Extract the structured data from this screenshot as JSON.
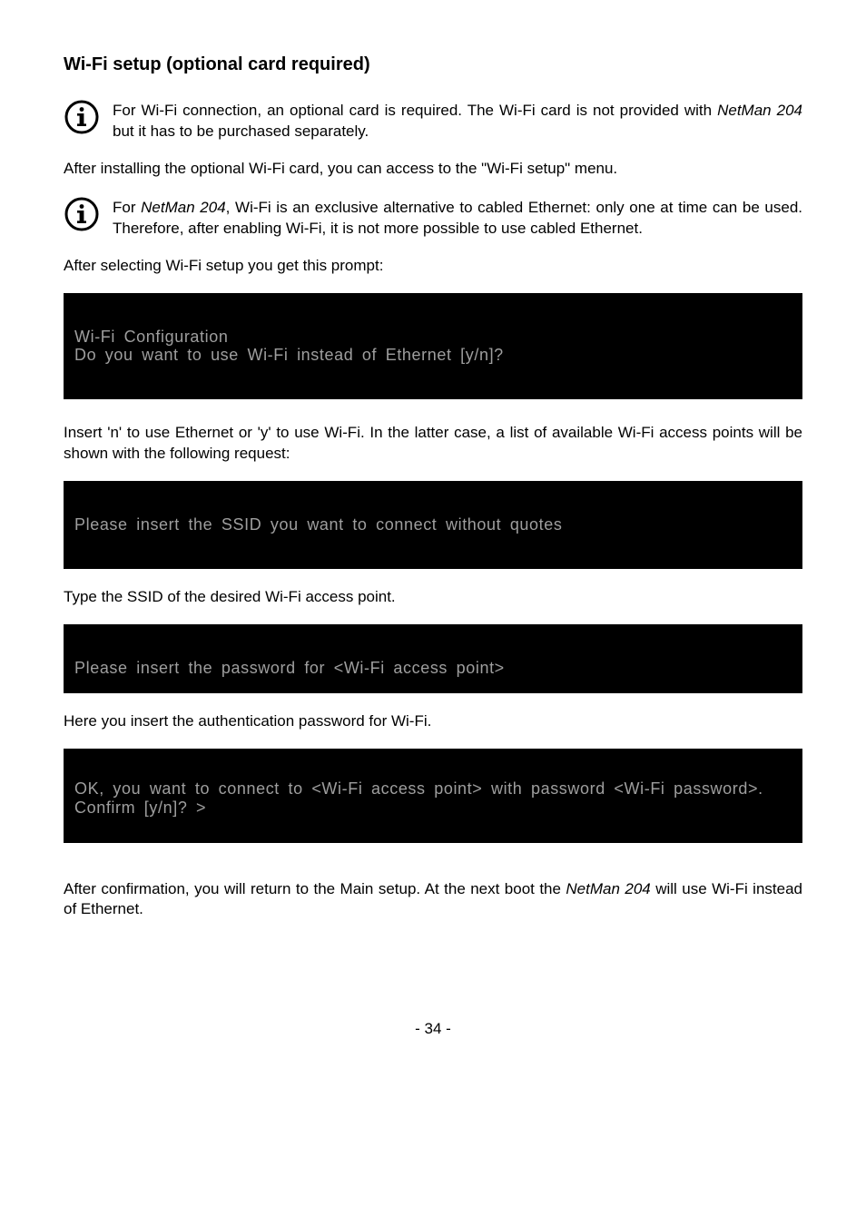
{
  "heading": "Wi-Fi setup (optional card required)",
  "info1_pre": "For Wi-Fi connection, an optional card is required. The Wi-Fi card is not provided with ",
  "info1_italic": "NetMan 204",
  "info1_post": " but it has to be purchased separately.",
  "para1": "After installing the optional Wi-Fi card, you can access to the \"Wi-Fi setup\" menu.",
  "info2_pre": "For ",
  "info2_italic": "NetMan 204",
  "info2_post": ", Wi-Fi is an exclusive alternative to cabled Ethernet: only one at time can be used. Therefore, after enabling Wi-Fi, it is not more possible to use cabled  Ethernet.",
  "para2": "After selecting Wi-Fi setup you get this prompt:",
  "term1": "Wi-Fi Configuration\nDo you want to use Wi-Fi instead of Ethernet [y/n]?",
  "para3": "Insert 'n' to use Ethernet or 'y' to use Wi-Fi. In the latter case, a list of available Wi-Fi access points will be shown with the following request:",
  "term2": "Please insert the SSID you want to connect without quotes",
  "para4": "Type the SSID of the desired Wi-Fi access point.",
  "term3": "Please insert the password for <Wi-Fi access point>",
  "para5": "Here you insert the authentication password for Wi-Fi.",
  "term4": "OK, you want to connect to <Wi-Fi access point> with password <Wi-Fi password>.\nConfirm [y/n]? >",
  "para6_pre": "After confirmation, you will return to the Main setup. At the next boot the ",
  "para6_italic": "NetMan 204",
  "para6_post": " will use Wi-Fi instead of Ethernet.",
  "page_number": "- 34 -"
}
